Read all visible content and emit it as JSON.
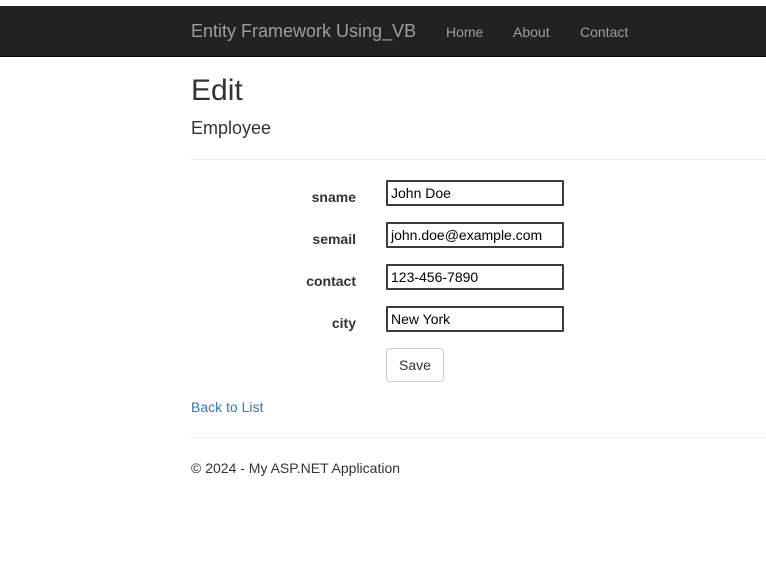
{
  "navbar": {
    "brand": "Entity Framework Using_VB",
    "links": [
      {
        "label": "Home"
      },
      {
        "label": "About"
      },
      {
        "label": "Contact"
      }
    ]
  },
  "main": {
    "title": "Edit",
    "subtitle": "Employee",
    "fields": [
      {
        "label": "sname",
        "value": "John Doe"
      },
      {
        "label": "semail",
        "value": "john.doe@example.com"
      },
      {
        "label": "contact",
        "value": "123-456-7890"
      },
      {
        "label": "city",
        "value": "New York"
      }
    ],
    "save_label": "Save",
    "back_link": "Back to List"
  },
  "footer": {
    "text": "© 2024 - My ASP.NET Application"
  },
  "colors": {
    "navbar_bg": "#222222",
    "nav_text": "#9d9d9d",
    "link": "#337ab7"
  }
}
